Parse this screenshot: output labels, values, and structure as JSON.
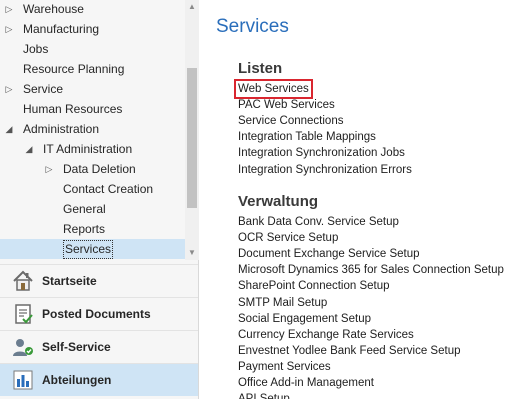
{
  "nav": {
    "tree": [
      {
        "label": "Warehouse",
        "level": 0,
        "expander": "collapsed"
      },
      {
        "label": "Manufacturing",
        "level": 0,
        "expander": "collapsed"
      },
      {
        "label": "Jobs",
        "level": 0,
        "expander": "none"
      },
      {
        "label": "Resource Planning",
        "level": 0,
        "expander": "none"
      },
      {
        "label": "Service",
        "level": 0,
        "expander": "collapsed"
      },
      {
        "label": "Human Resources",
        "level": 0,
        "expander": "none"
      },
      {
        "label": "Administration",
        "level": 0,
        "expander": "expanded"
      },
      {
        "label": "IT Administration",
        "level": 1,
        "expander": "expanded"
      },
      {
        "label": "Data Deletion",
        "level": 2,
        "expander": "collapsed"
      },
      {
        "label": "Contact Creation",
        "level": 2,
        "expander": "none"
      },
      {
        "label": "General",
        "level": 2,
        "expander": "none"
      },
      {
        "label": "Reports",
        "level": 2,
        "expander": "none"
      },
      {
        "label": "Services",
        "level": 2,
        "expander": "none",
        "selected": true
      }
    ],
    "areas": [
      {
        "label": "Startseite",
        "icon": "home-icon"
      },
      {
        "label": "Posted Documents",
        "icon": "posted-documents-icon"
      },
      {
        "label": "Self-Service",
        "icon": "self-service-icon"
      },
      {
        "label": "Abteilungen",
        "icon": "departments-icon",
        "active": true
      }
    ]
  },
  "main": {
    "title": "Services",
    "groups": [
      {
        "heading": "Listen",
        "links": [
          "Web Services",
          "PAC Web Services",
          "Service Connections",
          "Integration Table Mappings",
          "Integration Synchronization Jobs",
          "Integration Synchronization Errors"
        ]
      },
      {
        "heading": "Verwaltung",
        "links": [
          "Bank Data Conv. Service Setup",
          "OCR Service Setup",
          "Document Exchange Service Setup",
          "Microsoft Dynamics 365 for Sales Connection Setup",
          "SharePoint Connection Setup",
          "SMTP Mail Setup",
          "Social Engagement Setup",
          "Currency Exchange Rate Services",
          "Envestnet Yodlee Bank Feed Service Setup",
          "Payment Services",
          "Office Add-in Management",
          "API Setup"
        ]
      }
    ],
    "highlighted_link": "Web Services"
  },
  "colors": {
    "title": "#2a6ebb",
    "selection": "#cfe4f5",
    "highlight_border": "#d9262f",
    "nav_background": "#f6f6f6"
  }
}
